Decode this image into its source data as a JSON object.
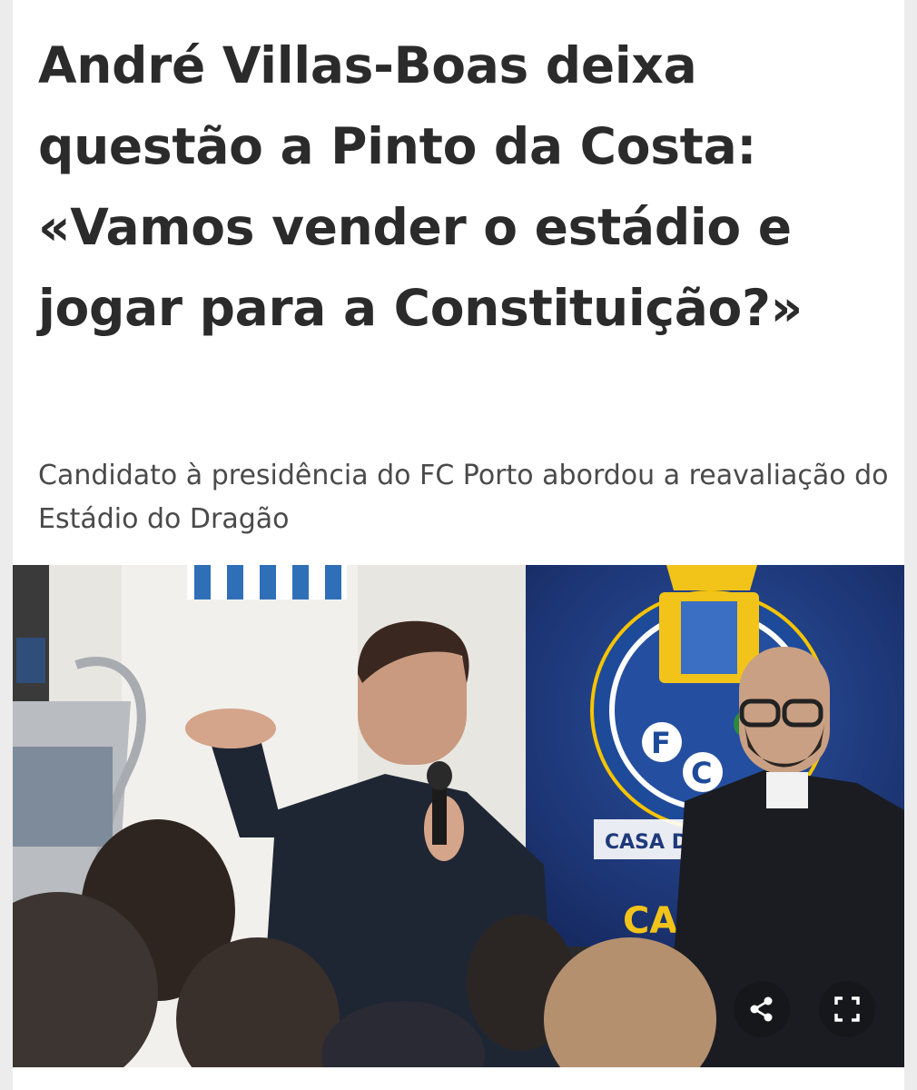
{
  "article": {
    "headline": "André Villas-Boas deixa questão a Pinto da Costa: «Vamos vender o estádio e jogar para a Constituição?»",
    "subtitle": "Candidato à presidência do FC Porto abordou a reavaliação do Estádio do Dragão"
  },
  "photo": {
    "banner_text": "CASA DOS",
    "banner_text_partial": "CAS",
    "crest_letters": [
      "F",
      "C"
    ]
  },
  "controls": {
    "share_icon": "share-icon",
    "expand_icon": "fullscreen-icon"
  }
}
